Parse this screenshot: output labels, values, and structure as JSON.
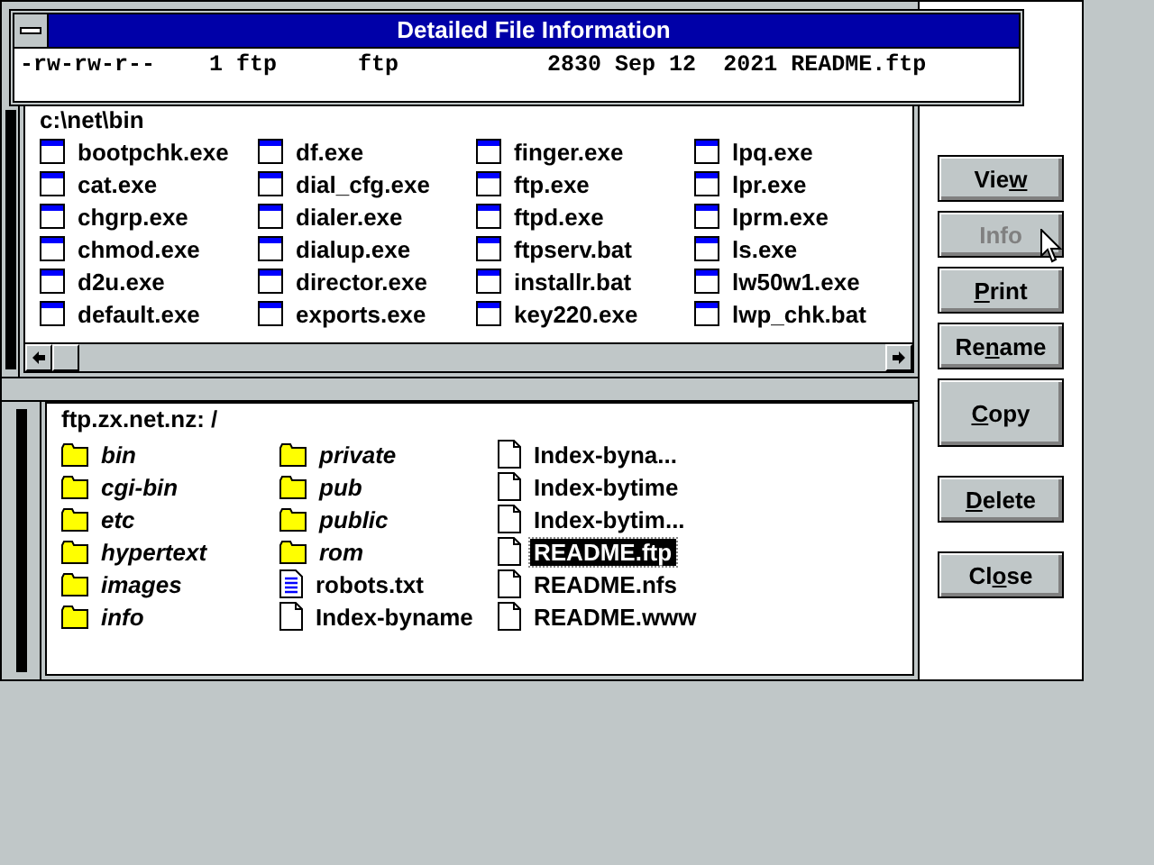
{
  "info_dialog": {
    "title": "Detailed File Information",
    "line": "-rw-rw-r--    1 ftp      ftp           2830 Sep 12  2021 README.ftp"
  },
  "local_pane": {
    "path": "c:\\net\\bin",
    "files": [
      {
        "name": "bootpchk.exe",
        "kind": "app",
        "selected": false
      },
      {
        "name": "cat.exe",
        "kind": "app",
        "selected": false
      },
      {
        "name": "chgrp.exe",
        "kind": "app",
        "selected": false
      },
      {
        "name": "chmod.exe",
        "kind": "app",
        "selected": false
      },
      {
        "name": "d2u.exe",
        "kind": "app",
        "selected": false
      },
      {
        "name": "default.exe",
        "kind": "app",
        "selected": false
      },
      {
        "name": "df.exe",
        "kind": "app",
        "selected": false
      },
      {
        "name": "dial_cfg.exe",
        "kind": "app",
        "selected": false
      },
      {
        "name": "dialer.exe",
        "kind": "app",
        "selected": false
      },
      {
        "name": "dialup.exe",
        "kind": "app",
        "selected": false
      },
      {
        "name": "director.exe",
        "kind": "app",
        "selected": false
      },
      {
        "name": "exports.exe",
        "kind": "app",
        "selected": false
      },
      {
        "name": "finger.exe",
        "kind": "app",
        "selected": false
      },
      {
        "name": "ftp.exe",
        "kind": "app",
        "selected": false
      },
      {
        "name": "ftpd.exe",
        "kind": "app",
        "selected": false
      },
      {
        "name": "ftpserv.bat",
        "kind": "app",
        "selected": false
      },
      {
        "name": "installr.bat",
        "kind": "app",
        "selected": false
      },
      {
        "name": "key220.exe",
        "kind": "app",
        "selected": false
      },
      {
        "name": "lpq.exe",
        "kind": "app",
        "selected": false
      },
      {
        "name": "lpr.exe",
        "kind": "app",
        "selected": false
      },
      {
        "name": "lprm.exe",
        "kind": "app",
        "selected": false
      },
      {
        "name": "ls.exe",
        "kind": "app",
        "selected": false
      },
      {
        "name": "lw50w1.exe",
        "kind": "app",
        "selected": false
      },
      {
        "name": "lwp_chk.bat",
        "kind": "app",
        "selected": false
      }
    ]
  },
  "remote_pane": {
    "path": "ftp.zx.net.nz: /",
    "files": [
      {
        "name": "bin",
        "kind": "folder",
        "selected": false
      },
      {
        "name": "cgi-bin",
        "kind": "folder",
        "selected": false
      },
      {
        "name": "etc",
        "kind": "folder",
        "selected": false
      },
      {
        "name": "hypertext",
        "kind": "folder",
        "selected": false
      },
      {
        "name": "images",
        "kind": "folder",
        "selected": false
      },
      {
        "name": "info",
        "kind": "folder",
        "selected": false
      },
      {
        "name": "private",
        "kind": "folder",
        "selected": false
      },
      {
        "name": "pub",
        "kind": "folder",
        "selected": false
      },
      {
        "name": "public",
        "kind": "folder",
        "selected": false
      },
      {
        "name": "rom",
        "kind": "folder",
        "selected": false
      },
      {
        "name": "robots.txt",
        "kind": "text",
        "selected": false
      },
      {
        "name": "Index-byname",
        "kind": "file",
        "selected": false
      },
      {
        "name": "Index-byna...",
        "kind": "file",
        "selected": false
      },
      {
        "name": "Index-bytime",
        "kind": "file",
        "selected": false
      },
      {
        "name": "Index-bytim...",
        "kind": "file",
        "selected": false
      },
      {
        "name": "README.ftp",
        "kind": "file",
        "selected": true
      },
      {
        "name": "README.nfs",
        "kind": "file",
        "selected": false
      },
      {
        "name": "README.www",
        "kind": "file",
        "selected": false
      }
    ]
  },
  "buttons": [
    {
      "label_start": "Vie",
      "access_key": "w",
      "disabled": false
    },
    {
      "label_start": "Info",
      "disabled": true
    },
    {
      "access_key": "P",
      "label_end": "rint",
      "disabled": false
    },
    {
      "label_start": "Re",
      "access_key": "n",
      "label_end": "ame",
      "disabled": false
    },
    {
      "access_key": "C",
      "label_end": "opy",
      "disabled": false
    },
    {
      "access_key": "D",
      "label_end": "elete",
      "disabled": false
    },
    {
      "label_start": "Cl",
      "access_key": "o",
      "label_end": "se",
      "disabled": false
    }
  ]
}
